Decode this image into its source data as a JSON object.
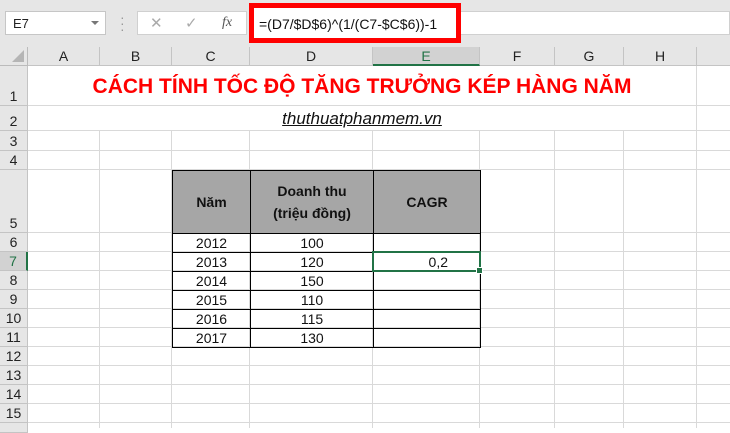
{
  "name_box": "E7",
  "formula": "=(D7/$D$6)^(1/(C7-$C$6))-1",
  "formula_buttons": {
    "cancel": "✕",
    "enter": "✓",
    "fx": "fx"
  },
  "columns": [
    "A",
    "B",
    "C",
    "D",
    "E",
    "F",
    "G",
    "H"
  ],
  "rows": [
    "1",
    "2",
    "3",
    "4",
    "5",
    "6",
    "7",
    "8",
    "9",
    "10",
    "11",
    "12",
    "13",
    "14",
    "15"
  ],
  "selected_cell": {
    "col": "E",
    "row": "7"
  },
  "title": "CÁCH TÍNH TỐC ĐỘ TĂNG TRƯỞNG KÉP HÀNG NĂM",
  "subtitle": "thuthuatphanmem.vn",
  "table": {
    "headers": [
      "Năm",
      "Doanh thu\n(triệu đồng)",
      "CAGR"
    ],
    "rows": [
      [
        "2012",
        "100",
        ""
      ],
      [
        "2013",
        "120",
        "0,2"
      ],
      [
        "2014",
        "150",
        ""
      ],
      [
        "2015",
        "110",
        ""
      ],
      [
        "2016",
        "115",
        ""
      ],
      [
        "2017",
        "130",
        ""
      ]
    ]
  },
  "colors": {
    "accent": "#217346",
    "title": "#ff0000",
    "header_fill": "#a6a6a6",
    "highlight": "#ff0000"
  }
}
